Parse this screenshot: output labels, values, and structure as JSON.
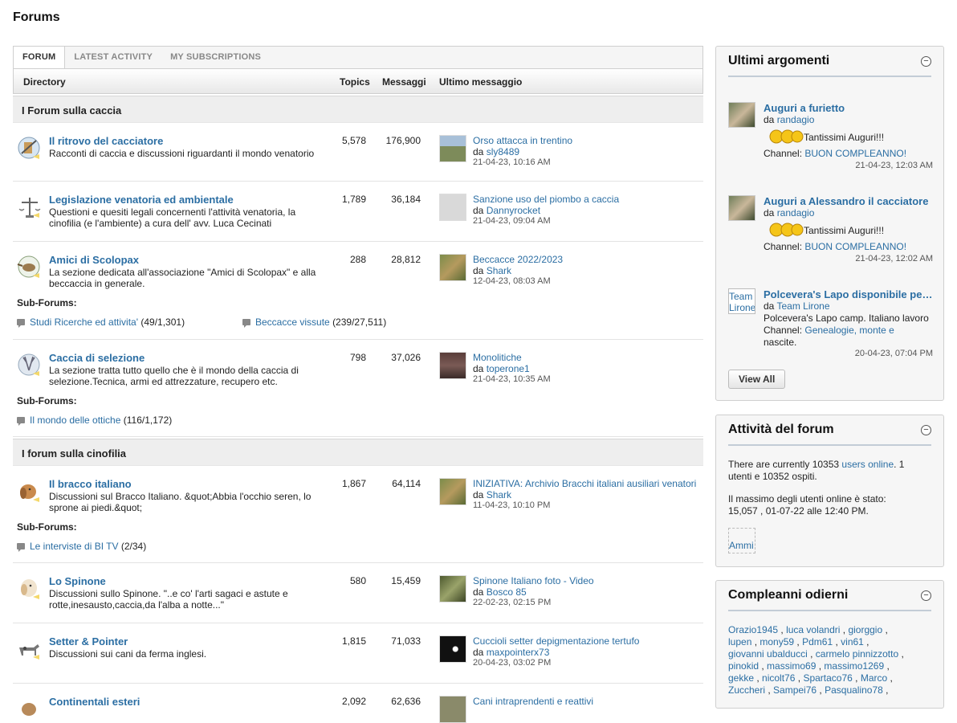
{
  "page": {
    "title": "Forums"
  },
  "tabs": [
    "FORUM",
    "LATEST ACTIVITY",
    "MY SUBSCRIPTIONS"
  ],
  "columns": {
    "directory": "Directory",
    "topics": "Topics",
    "messages": "Messaggi",
    "last": "Ultimo messaggio"
  },
  "sections": [
    {
      "title": "I Forum sulla caccia"
    },
    {
      "title": "I forum sulla cinofilia"
    }
  ],
  "sub_forums_label": "Sub-Forums:",
  "forums": [
    {
      "name": "Il ritrovo del cacciatore",
      "desc": "Racconti di caccia e discussioni riguardanti il mondo venatorio",
      "topics": "5,578",
      "messages": "176,900",
      "last_title": "Orso attacca in trentino",
      "last_by": "da ",
      "last_user": "sly8489",
      "last_date": "21-04-23, 10:16 AM",
      "icon": "hunter-icon"
    },
    {
      "name": "Legislazione venatoria ed ambientale",
      "desc": "Questioni e quesiti legali concernenti l'attività venatoria, la cinofilia (e l'ambiente) a cura dell' avv. Luca Cecinati",
      "topics": "1,789",
      "messages": "36,184",
      "last_title": "Sanzione uso del piombo a caccia",
      "last_by": "da ",
      "last_user": "Dannyrocket",
      "last_date": "21-04-23, 09:04 AM",
      "icon": "scales-icon"
    },
    {
      "name": "Amici di Scolopax",
      "desc": "La sezione dedicata all'associazione \"Amici di Scolopax\" e alla beccaccia in generale.",
      "topics": "288",
      "messages": "28,812",
      "last_title": "Beccacce 2022/2023",
      "last_by": "da ",
      "last_user": "Shark",
      "last_date": "12-04-23, 08:03 AM",
      "icon": "woodcock-icon",
      "subforums": [
        {
          "name": "Studi Ricerche ed attivita'",
          "count": "(49/1,301)"
        },
        {
          "name": "Beccacce vissute",
          "count": "(239/27,511)"
        }
      ]
    },
    {
      "name": "Caccia di selezione",
      "desc": "La sezione tratta tutto quello che è il mondo della caccia di selezione.Tecnica, armi ed attrezzature, recupero etc.",
      "topics": "798",
      "messages": "37,026",
      "last_title": "Monolitiche",
      "last_by": "da ",
      "last_user": "toperone1",
      "last_date": "21-04-23, 10:35 AM",
      "icon": "deer-icon",
      "subforums": [
        {
          "name": "Il mondo delle ottiche",
          "count": "(116/1,172)"
        }
      ]
    },
    {
      "name": "Il bracco italiano",
      "desc": "Discussioni sul Bracco Italiano. &quot;Abbia l'occhio seren, lo sprone ai piedi.&quot;",
      "topics": "1,867",
      "messages": "64,114",
      "last_title": "INIZIATIVA: Archivio Bracchi italiani ausiliari venatori",
      "last_by": "da ",
      "last_user": "Shark",
      "last_date": "11-04-23, 10:10 PM",
      "icon": "bracco-icon",
      "subforums": [
        {
          "name": "Le interviste di BI TV",
          "count": "(2/34)"
        }
      ]
    },
    {
      "name": "Lo Spinone",
      "desc": "Discussioni sullo Spinone. \"..e co' l'arti sagaci e astute e rotte,inesausto,caccia,da l'alba a notte...\"",
      "topics": "580",
      "messages": "15,459",
      "last_title": "Spinone Italiano foto - Video",
      "last_by": "da ",
      "last_user": "Bosco 85",
      "last_date": "22-02-23, 02:15 PM",
      "icon": "spinone-icon"
    },
    {
      "name": "Setter & Pointer",
      "desc": "Discussioni sui cani da ferma inglesi.",
      "topics": "1,815",
      "messages": "71,033",
      "last_title": "Cuccioli setter depigmentazione tertufo",
      "last_by": "da ",
      "last_user": "maxpointerx73",
      "last_date": "20-04-23, 03:02 PM",
      "icon": "setter-icon"
    },
    {
      "name": "Continentali esteri",
      "desc": "",
      "topics": "2,092",
      "messages": "62,636",
      "last_title": "Cani intraprendenti e reattivi",
      "last_by": "",
      "last_user": "",
      "last_date": "",
      "icon": "dog-icon"
    }
  ],
  "sidebar": {
    "latest": {
      "title": "Ultimi argomenti",
      "items": [
        {
          "title": "Auguri a furietto",
          "by": "da ",
          "user": "randagio",
          "text": "Tantissimi Auguri!!!",
          "channel_label": "Channel: ",
          "channel": "BUON COMPLEANNO!",
          "date": "21-04-23, 12:03 AM"
        },
        {
          "title": "Auguri a Alessandro il cacciatore",
          "by": "da ",
          "user": "randagio",
          "text": "Tantissimi Auguri!!!",
          "channel_label": "Channel: ",
          "channel": "BUON COMPLEANNO!",
          "date": "21-04-23, 12:02 AM"
        },
        {
          "title": "Polcevera's Lapo disponibile per monte",
          "by": "da ",
          "user": "Team Lirone",
          "text": "Polcevera's Lapo camp. Italiano lavoro",
          "channel_label": "Channel: ",
          "channel": "Genealogie, monte e",
          "channel2": "nascite.",
          "date": "20-04-23, 07:04 PM",
          "avatar_alt": "Team Lirone"
        }
      ],
      "view_all": "View All"
    },
    "activity": {
      "title": "Attività del forum",
      "line1_a": "There are currently 10353 ",
      "line1_link": "users online",
      "line1_b": ". 1",
      "line2": "utenti e 10352 ospiti.",
      "line3": "Il massimo degli utenti online è stato:",
      "line4": "15,057 , 01-07-22 alle 12:40 PM.",
      "img_alt": "Ammi"
    },
    "birthdays": {
      "title": "Compleanni odierni",
      "rows": [
        [
          "Orazio1945",
          "luca volandri",
          "giorggio"
        ],
        [
          "lupen",
          "mony59",
          "Pdm61",
          "vin61"
        ],
        [
          "giovanni ubalducci",
          "carmelo pinnizzotto"
        ],
        [
          "pinokid",
          "massimo69",
          "massimo1269"
        ],
        [
          "gekke",
          "nicolt76",
          "Spartaco76",
          "Marco"
        ],
        [
          "Zuccheri",
          "Sampei76",
          "Pasqualino78"
        ]
      ]
    }
  }
}
